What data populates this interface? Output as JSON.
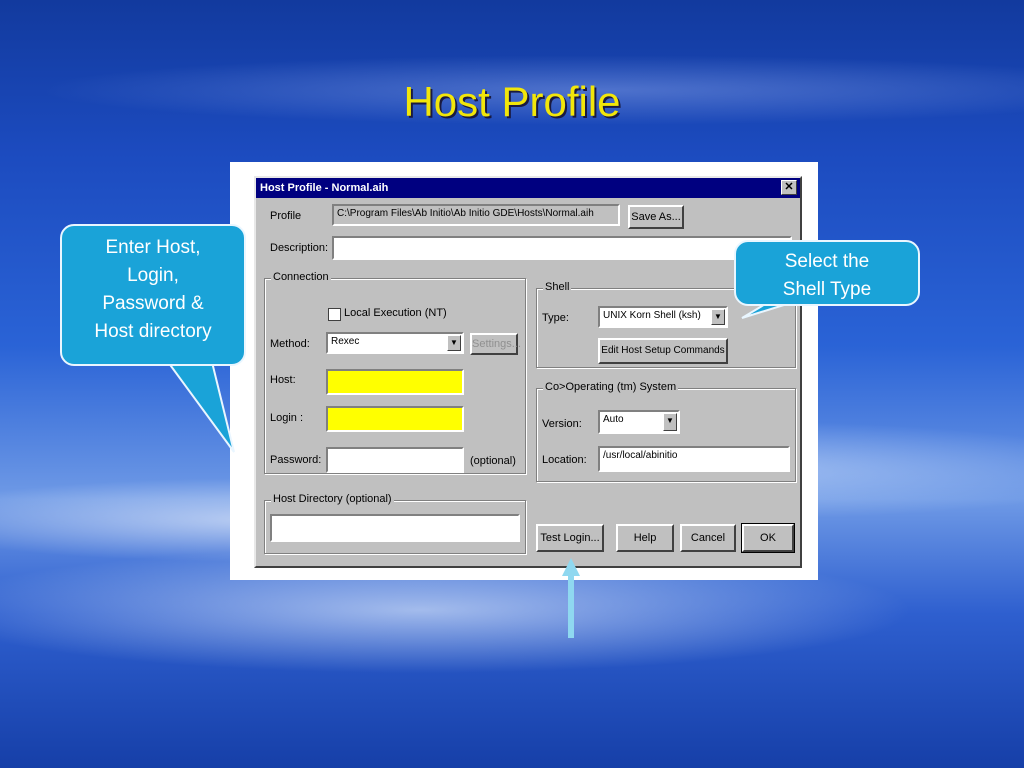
{
  "slide": {
    "title": "Host Profile"
  },
  "dialog": {
    "title": "Host Profile  - Normal.aih",
    "close_glyph": "✕",
    "profile_label": "Profile",
    "profile_value": "C:\\Program Files\\Ab Initio\\Ab Initio GDE\\Hosts\\Normal.aih",
    "save_as": "Save As...",
    "description_label": "Description:",
    "description_value": "",
    "connection": {
      "title": "Connection",
      "local_exec": "Local Execution (NT)",
      "method_label": "Method:",
      "method_value": "Rexec",
      "settings": "Settings...",
      "host_label": "Host:",
      "host_value": "",
      "login_label": "Login :",
      "login_value": "",
      "password_label": "Password:",
      "password_value": "",
      "optional": "(optional)"
    },
    "shell": {
      "title": "Shell",
      "type_label": "Type:",
      "type_value": "UNIX Korn Shell (ksh)",
      "edit_btn": "Edit Host Setup Commands"
    },
    "os": {
      "title": "Co>Operating (tm) System",
      "version_label": "Version:",
      "version_value": "Auto",
      "location_label": "Location:",
      "location_value": "/usr/local/abinitio"
    },
    "host_dir": {
      "title": "Host Directory (optional)",
      "value": ""
    },
    "buttons": {
      "test_login": "Test Login...",
      "help": "Help",
      "cancel": "Cancel",
      "ok": "OK"
    }
  },
  "callouts": {
    "left": [
      "Enter Host,",
      "Login,",
      "Password &",
      "Host directory"
    ],
    "right": [
      "Select the",
      "Shell Type"
    ]
  },
  "icons": {
    "dropdown": "▼"
  },
  "colors": {
    "title": "#f2e60a",
    "callout": "#1aa3d8",
    "highlight": "#ffff00",
    "titlebar": "#000080"
  }
}
